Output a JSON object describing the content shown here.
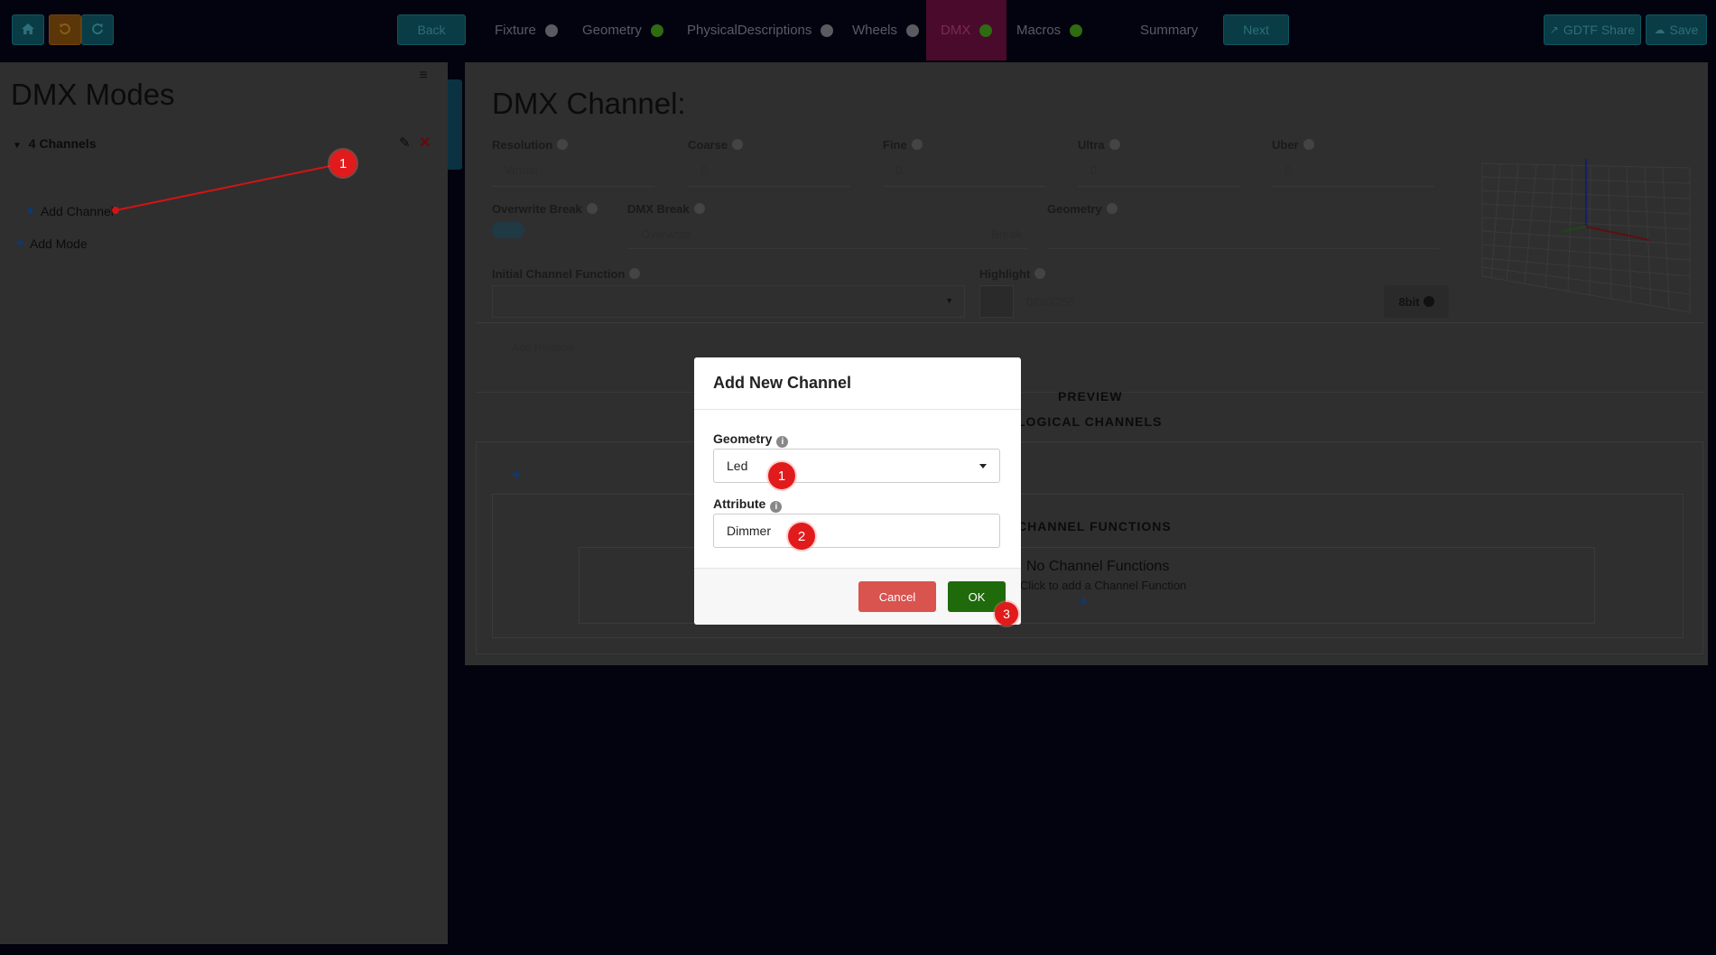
{
  "topbar": {
    "back_label": "Back",
    "next_label": "Next",
    "share_label": "GDTF Share",
    "save_label": "Save",
    "nav": [
      {
        "label": "Fixture",
        "status": "grey"
      },
      {
        "label": "Geometry",
        "status": "green"
      },
      {
        "label": "PhysicalDescriptions",
        "status": "grey"
      },
      {
        "label": "Wheels",
        "status": "grey"
      },
      {
        "label": "DMX",
        "status": "green"
      },
      {
        "label": "Macros",
        "status": "green"
      },
      {
        "label": "Summary",
        "status": "none"
      }
    ]
  },
  "sidebar": {
    "title": "DMX Modes",
    "mode_name": "4 Channels",
    "add_channel_label": "Add Channel",
    "add_mode_label": "Add Mode"
  },
  "main": {
    "title": "DMX Channel:",
    "resolution_label": "Resolution",
    "resolution_value": "Virtual",
    "coarse_label": "Coarse",
    "coarse_value": "0",
    "fine_label": "Fine",
    "fine_value": "0",
    "ultra_label": "Ultra",
    "ultra_value": "0",
    "uber_label": "Uber",
    "uber_value": "0",
    "overwrite_break_label": "Overwrite Break",
    "dmx_break_label": "DMX Break",
    "dmx_break_placeholder": "Overwrite",
    "dmx_break_suffix": "Break",
    "geometry_label": "Geometry",
    "initial_function_label": "Initial Channel Function",
    "highlight_label": "Highlight",
    "highlight_value": "0/0/0/255",
    "bit_label": "8bit",
    "add_relation_label": "Add Relation",
    "preview_label": "PREVIEW",
    "logical_channels_label": "LOGICAL CHANNELS",
    "channel_functions_label": "CHANNEL FUNCTIONS",
    "no_functions_title": "No Channel Functions",
    "no_functions_hint": "Click to add a Channel Function"
  },
  "modal": {
    "title": "Add New Channel",
    "geometry_label": "Geometry",
    "geometry_value": "Led",
    "attribute_label": "Attribute",
    "attribute_value": "Dimmer",
    "cancel_label": "Cancel",
    "ok_label": "OK"
  },
  "annotations": {
    "m1": "1",
    "m2": "1",
    "m3": "2",
    "m4": "3"
  },
  "colors": {
    "accent_red": "#e11b1b",
    "ok_green": "#1f6a0b",
    "cancel_red": "#d9534f"
  }
}
